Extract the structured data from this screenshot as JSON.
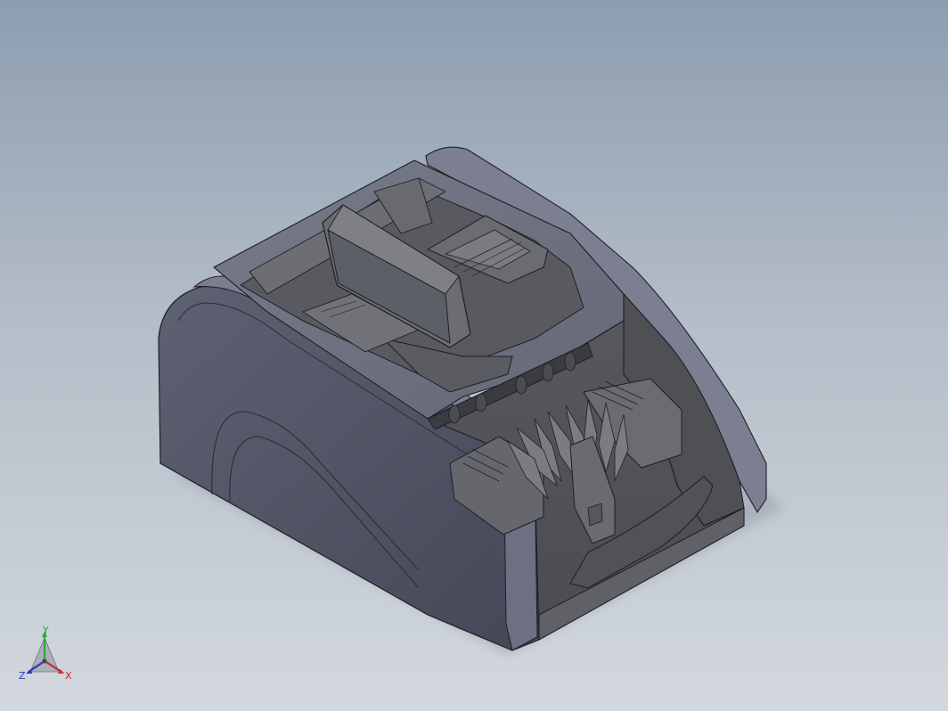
{
  "viewport": {
    "title": "",
    "background_top": "#8d9db0",
    "background_bottom": "#d3d8de"
  },
  "model": {
    "name": "banknote-counter-model",
    "body_color": "#6a6e7e",
    "panel_color": "#5c5c5c",
    "edge_color": "#1e1e24"
  },
  "triad": {
    "y_label": "Y",
    "x_label": "X",
    "z_label": "Z",
    "y_color": "#2ea836",
    "x_color": "#c8282c",
    "z_color": "#2a3ab4"
  }
}
